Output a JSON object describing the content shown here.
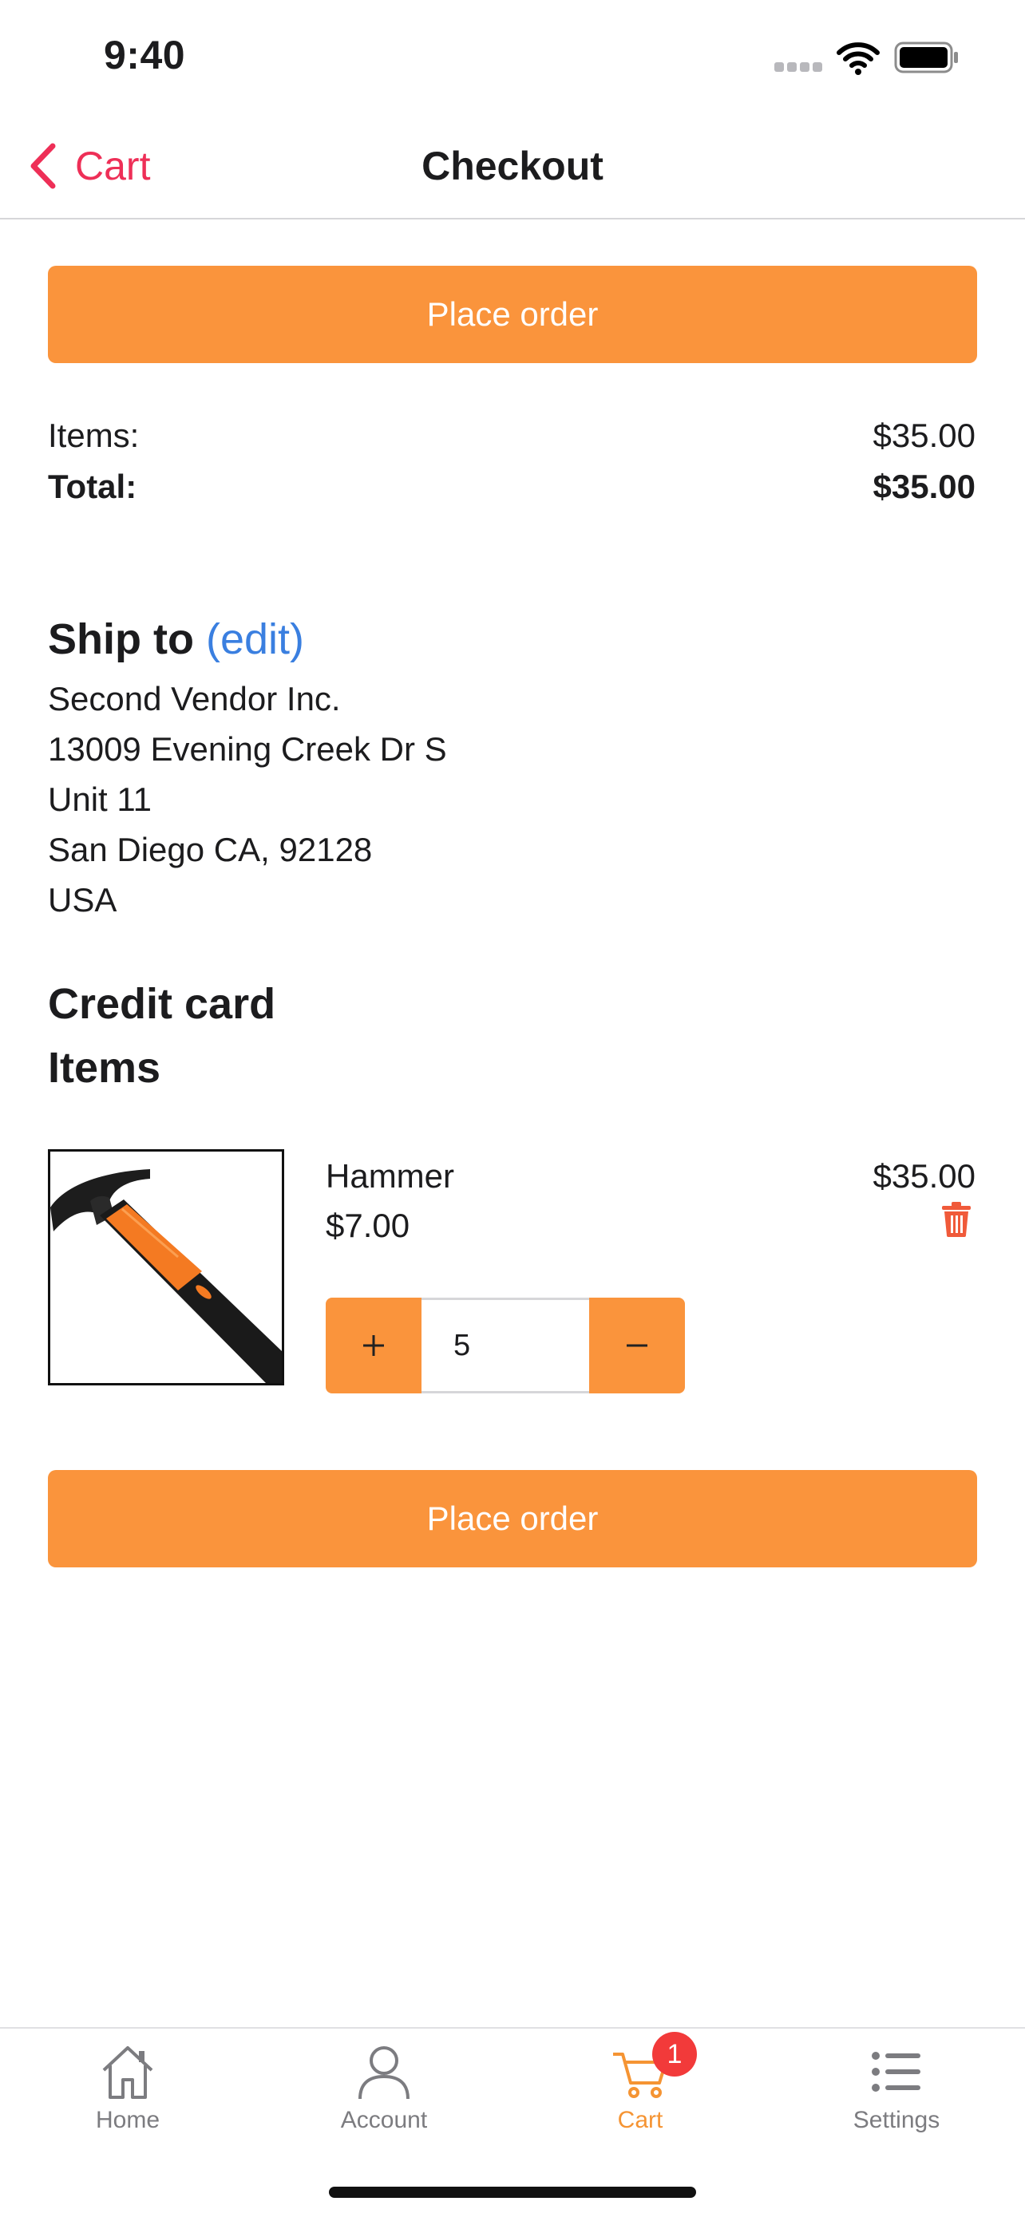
{
  "status_bar": {
    "time": "9:40"
  },
  "nav": {
    "back_label": "Cart",
    "title": "Checkout"
  },
  "buttons": {
    "place_order_top": "Place order",
    "place_order_bottom": "Place order"
  },
  "summary": {
    "items_label": "Items:",
    "items_value": "$35.00",
    "total_label": "Total:",
    "total_value": "$35.00"
  },
  "ship_to": {
    "title": "Ship to",
    "edit_label": "(edit)",
    "address_lines": [
      "Second Vendor Inc.",
      "13009 Evening Creek Dr S",
      "Unit 11",
      "San Diego CA, 92128",
      "USA"
    ]
  },
  "sections": {
    "credit_card": "Credit card",
    "items": "Items"
  },
  "cart_item": {
    "name": "Hammer",
    "unit_price": "$7.00",
    "line_total": "$35.00",
    "quantity": "5",
    "image_icon": "hammer-image",
    "delete_icon": "trash-icon"
  },
  "tab_bar": {
    "tabs": [
      {
        "label": "Home",
        "icon": "house-icon",
        "active": false
      },
      {
        "label": "Account",
        "icon": "person-icon",
        "active": false
      },
      {
        "label": "Cart",
        "icon": "cart-icon",
        "active": true,
        "badge": "1"
      },
      {
        "label": "Settings",
        "icon": "list-icon",
        "active": false
      }
    ]
  },
  "colors": {
    "accent": "#fa943c",
    "back": "#ee2f57",
    "link": "#3a7fe0",
    "badge": "#f23a3a",
    "delete": "#f05a3a"
  }
}
